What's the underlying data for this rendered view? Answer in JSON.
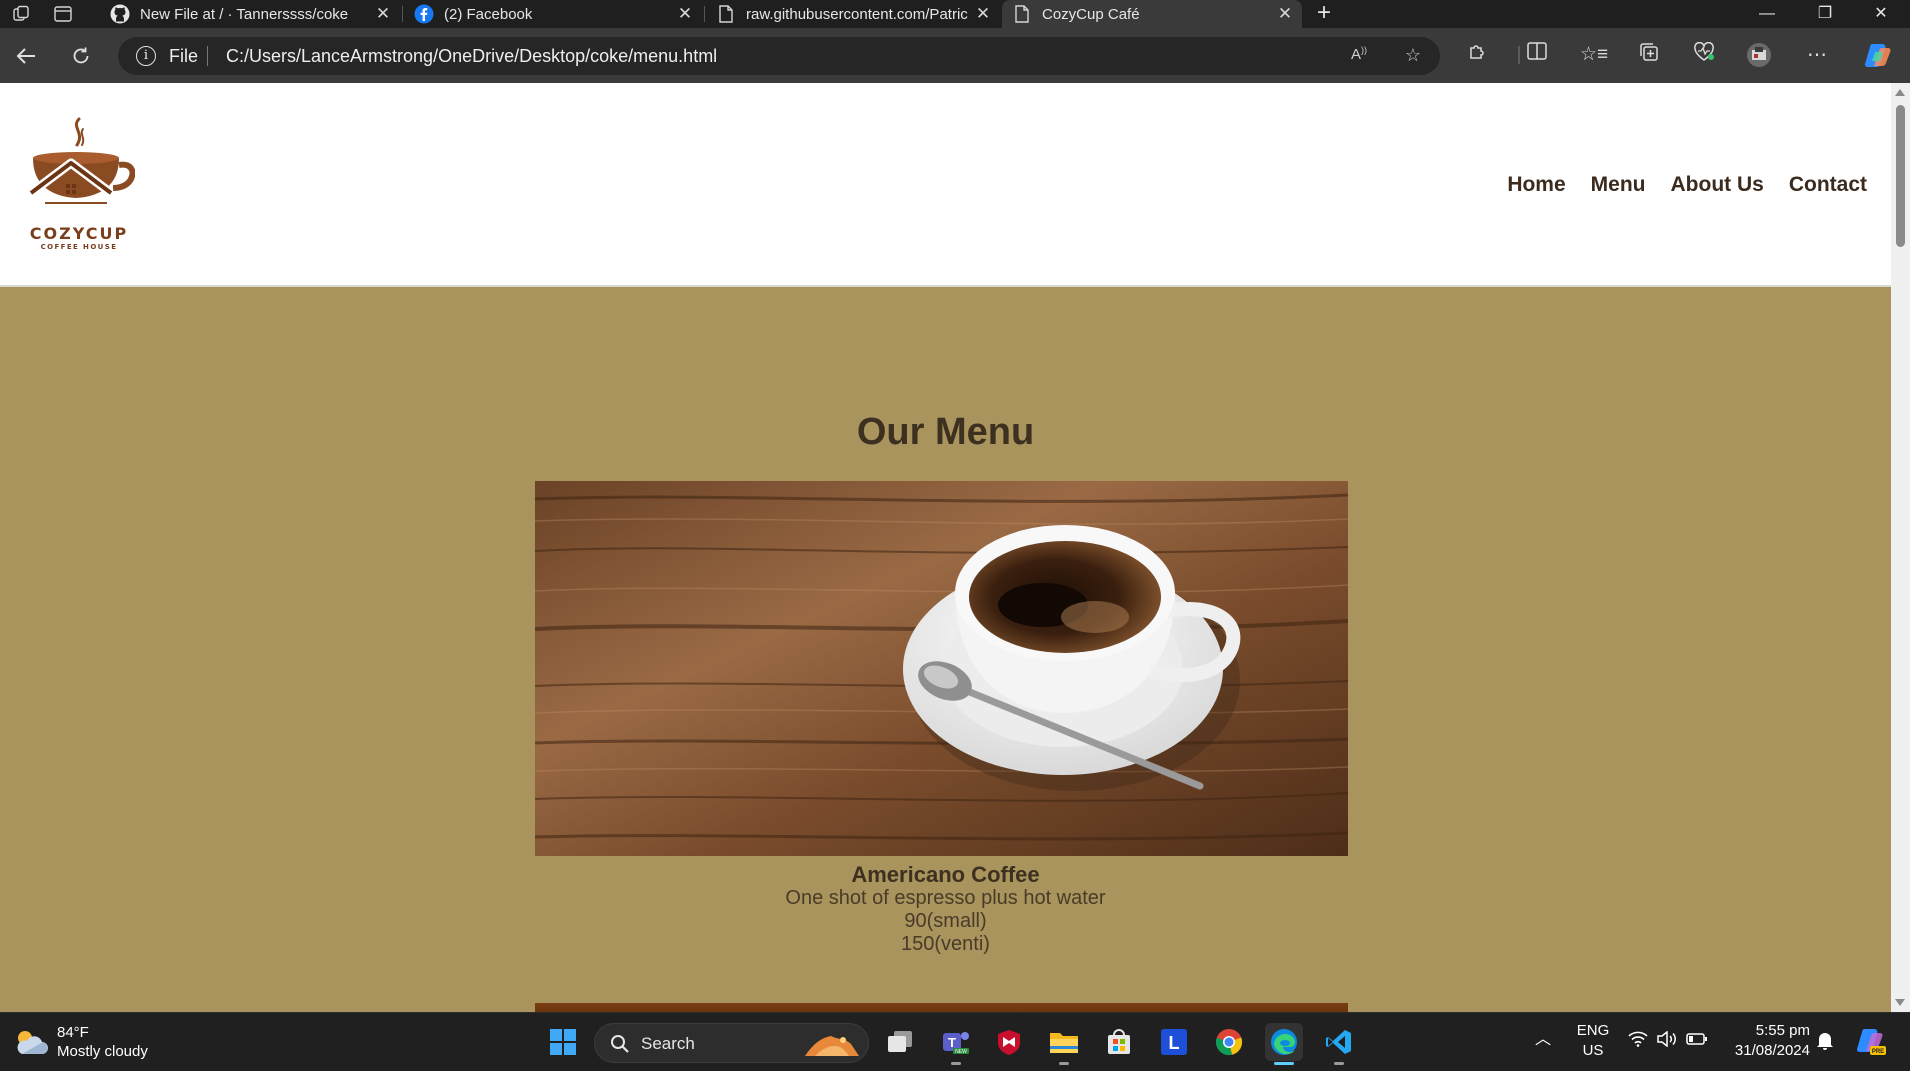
{
  "browser": {
    "tabs": [
      {
        "title": "New File at / · Tannerssss/coke",
        "icon": "github-icon"
      },
      {
        "title": "(2) Facebook",
        "icon": "facebook-icon"
      },
      {
        "title": "raw.githubusercontent.com/Patric",
        "icon": "page-icon"
      },
      {
        "title": "CozyCup Café",
        "icon": "page-icon",
        "active": true
      }
    ],
    "address": {
      "protocol": "File",
      "url": "C:/Users/LanceArmstrong/OneDrive/Desktop/coke/menu.html"
    }
  },
  "site": {
    "logo": {
      "name": "COZYCUP",
      "tagline": "COFFEE HOUSE"
    },
    "nav": [
      "Home",
      "Menu",
      "About Us",
      "Contact"
    ],
    "menu_title": "Our Menu",
    "item": {
      "name": "Americano Coffee",
      "description": "One shot of espresso plus hot water",
      "price_small": "90(small)",
      "price_venti": "150(venti)"
    }
  },
  "taskbar": {
    "weather": {
      "temp": "84°F",
      "condition": "Mostly cloudy"
    },
    "search_label": "Search",
    "language": {
      "lang": "ENG",
      "region": "US"
    },
    "clock": {
      "time": "5:55 pm",
      "date": "31/08/2024"
    }
  },
  "colors": {
    "page_background": "#a8945c",
    "header_background": "#ffffff",
    "brand_brown": "#7a3e1c",
    "text_dark": "#3d3020"
  }
}
